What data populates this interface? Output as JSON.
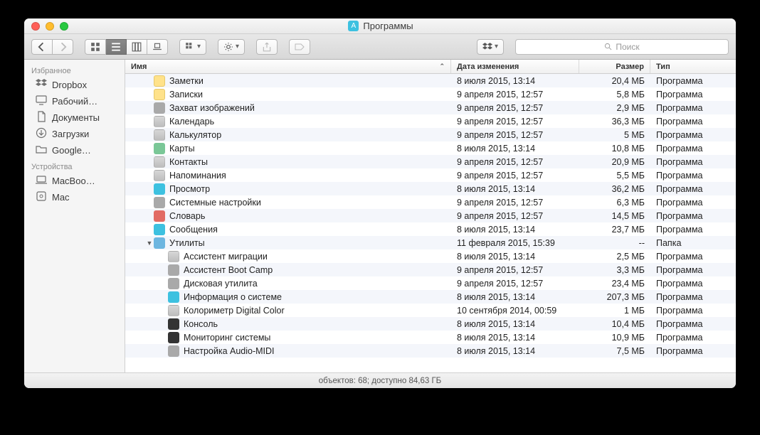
{
  "window": {
    "title": "Программы"
  },
  "toolbar": {
    "search_placeholder": "Поиск"
  },
  "sidebar": {
    "favorites_label": "Избранное",
    "devices_label": "Устройства",
    "favorites": [
      {
        "label": "Dropbox",
        "icon": "dropbox"
      },
      {
        "label": "Рабочий…",
        "icon": "desktop"
      },
      {
        "label": "Документы",
        "icon": "documents"
      },
      {
        "label": "Загрузки",
        "icon": "downloads"
      },
      {
        "label": "Google…",
        "icon": "folder"
      }
    ],
    "devices": [
      {
        "label": "MacBoo…",
        "icon": "laptop"
      },
      {
        "label": "Mac",
        "icon": "disk"
      }
    ]
  },
  "columns": {
    "name": "Имя",
    "date": "Дата изменения",
    "size": "Размер",
    "kind": "Тип"
  },
  "items": [
    {
      "name": "Заметки",
      "date": "8 июля 2015, 13:14",
      "size": "20,4 МБ",
      "kind": "Программа",
      "depth": 0,
      "icon": "yel"
    },
    {
      "name": "Записки",
      "date": "9 апреля 2015, 12:57",
      "size": "5,8 МБ",
      "kind": "Программа",
      "depth": 0,
      "icon": "yel"
    },
    {
      "name": "Захват изображений",
      "date": "9 апреля 2015, 12:57",
      "size": "2,9 МБ",
      "kind": "Программа",
      "depth": 0,
      "icon": "gray"
    },
    {
      "name": "Календарь",
      "date": "9 апреля 2015, 12:57",
      "size": "36,3 МБ",
      "kind": "Программа",
      "depth": 0,
      "icon": "app"
    },
    {
      "name": "Калькулятор",
      "date": "9 апреля 2015, 12:57",
      "size": "5 МБ",
      "kind": "Программа",
      "depth": 0,
      "icon": "app"
    },
    {
      "name": "Карты",
      "date": "8 июля 2015, 13:14",
      "size": "10,8 МБ",
      "kind": "Программа",
      "depth": 0,
      "icon": "grn"
    },
    {
      "name": "Контакты",
      "date": "9 апреля 2015, 12:57",
      "size": "20,9 МБ",
      "kind": "Программа",
      "depth": 0,
      "icon": "app"
    },
    {
      "name": "Напоминания",
      "date": "9 апреля 2015, 12:57",
      "size": "5,5 МБ",
      "kind": "Программа",
      "depth": 0,
      "icon": "app"
    },
    {
      "name": "Просмотр",
      "date": "8 июля 2015, 13:14",
      "size": "36,2 МБ",
      "kind": "Программа",
      "depth": 0,
      "icon": "blue"
    },
    {
      "name": "Системные настройки",
      "date": "9 апреля 2015, 12:57",
      "size": "6,3 МБ",
      "kind": "Программа",
      "depth": 0,
      "icon": "gray"
    },
    {
      "name": "Словарь",
      "date": "9 апреля 2015, 12:57",
      "size": "14,5 МБ",
      "kind": "Программа",
      "depth": 0,
      "icon": "red"
    },
    {
      "name": "Сообщения",
      "date": "8 июля 2015, 13:14",
      "size": "23,7 МБ",
      "kind": "Программа",
      "depth": 0,
      "icon": "blue"
    },
    {
      "name": "Утилиты",
      "date": "11 февраля 2015, 15:39",
      "size": "--",
      "kind": "Папка",
      "depth": 0,
      "icon": "folder",
      "expanded": true
    },
    {
      "name": "Ассистент миграции",
      "date": "8 июля 2015, 13:14",
      "size": "2,5 МБ",
      "kind": "Программа",
      "depth": 1,
      "icon": "app"
    },
    {
      "name": "Ассистент Boot Camp",
      "date": "9 апреля 2015, 12:57",
      "size": "3,3 МБ",
      "kind": "Программа",
      "depth": 1,
      "icon": "gray"
    },
    {
      "name": "Дисковая утилита",
      "date": "9 апреля 2015, 12:57",
      "size": "23,4 МБ",
      "kind": "Программа",
      "depth": 1,
      "icon": "gray"
    },
    {
      "name": "Информация о системе",
      "date": "8 июля 2015, 13:14",
      "size": "207,3 МБ",
      "kind": "Программа",
      "depth": 1,
      "icon": "blue"
    },
    {
      "name": "Колориметр Digital Color",
      "date": "10 сентября 2014, 00:59",
      "size": "1 МБ",
      "kind": "Программа",
      "depth": 1,
      "icon": "app"
    },
    {
      "name": "Консоль",
      "date": "8 июля 2015, 13:14",
      "size": "10,4 МБ",
      "kind": "Программа",
      "depth": 1,
      "icon": "dark"
    },
    {
      "name": "Мониторинг системы",
      "date": "8 июля 2015, 13:14",
      "size": "10,9 МБ",
      "kind": "Программа",
      "depth": 1,
      "icon": "dark"
    },
    {
      "name": "Настройка Audio-MIDI",
      "date": "8 июля 2015, 13:14",
      "size": "7,5 МБ",
      "kind": "Программа",
      "depth": 1,
      "icon": "gray"
    }
  ],
  "status": "объектов: 68; доступно 84,63 ГБ"
}
